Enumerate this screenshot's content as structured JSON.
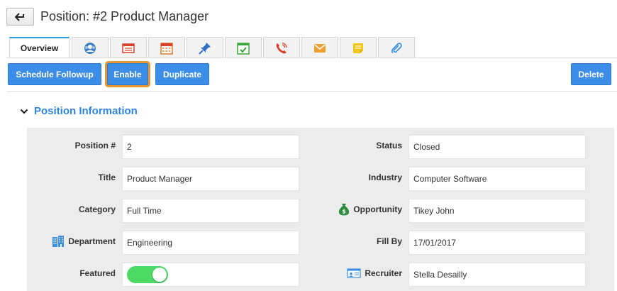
{
  "header": {
    "title": "Position: #2 Product Manager"
  },
  "tabs": [
    {
      "label": "Overview",
      "icon": ""
    },
    {
      "label": "",
      "icon": "contacts-icon"
    },
    {
      "label": "",
      "icon": "notes-list-icon"
    },
    {
      "label": "",
      "icon": "calendar-icon"
    },
    {
      "label": "",
      "icon": "pin-icon"
    },
    {
      "label": "",
      "icon": "task-check-icon"
    },
    {
      "label": "",
      "icon": "phone-call-icon"
    },
    {
      "label": "",
      "icon": "email-icon"
    },
    {
      "label": "",
      "icon": "sticky-note-icon"
    },
    {
      "label": "",
      "icon": "paperclip-icon"
    }
  ],
  "toolbar": {
    "schedule_followup": "Schedule Followup",
    "enable": "Enable",
    "duplicate": "Duplicate",
    "delete": "Delete"
  },
  "section": {
    "title": "Position Information"
  },
  "fields": {
    "position_no": {
      "label": "Position #",
      "value": "2"
    },
    "title": {
      "label": "Title",
      "value": "Product Manager"
    },
    "category": {
      "label": "Category",
      "value": "Full Time"
    },
    "department": {
      "label": "Department",
      "value": "Engineering"
    },
    "featured": {
      "label": "Featured",
      "value": true
    },
    "status": {
      "label": "Status",
      "value": "Closed"
    },
    "industry": {
      "label": "Industry",
      "value": "Computer Software"
    },
    "opportunity": {
      "label": "Opportunity",
      "value": "Tikey John"
    },
    "fill_by": {
      "label": "Fill By",
      "value": "17/01/2017"
    },
    "recruiter": {
      "label": "Recruiter",
      "value": "Stella Desailly"
    }
  },
  "colors": {
    "primary_button": "#3b8de8",
    "highlight_outline": "#e8952f",
    "section_title": "#2e86de",
    "toggle_on": "#4cd964",
    "active_tab_border": "#2e9bd6"
  }
}
